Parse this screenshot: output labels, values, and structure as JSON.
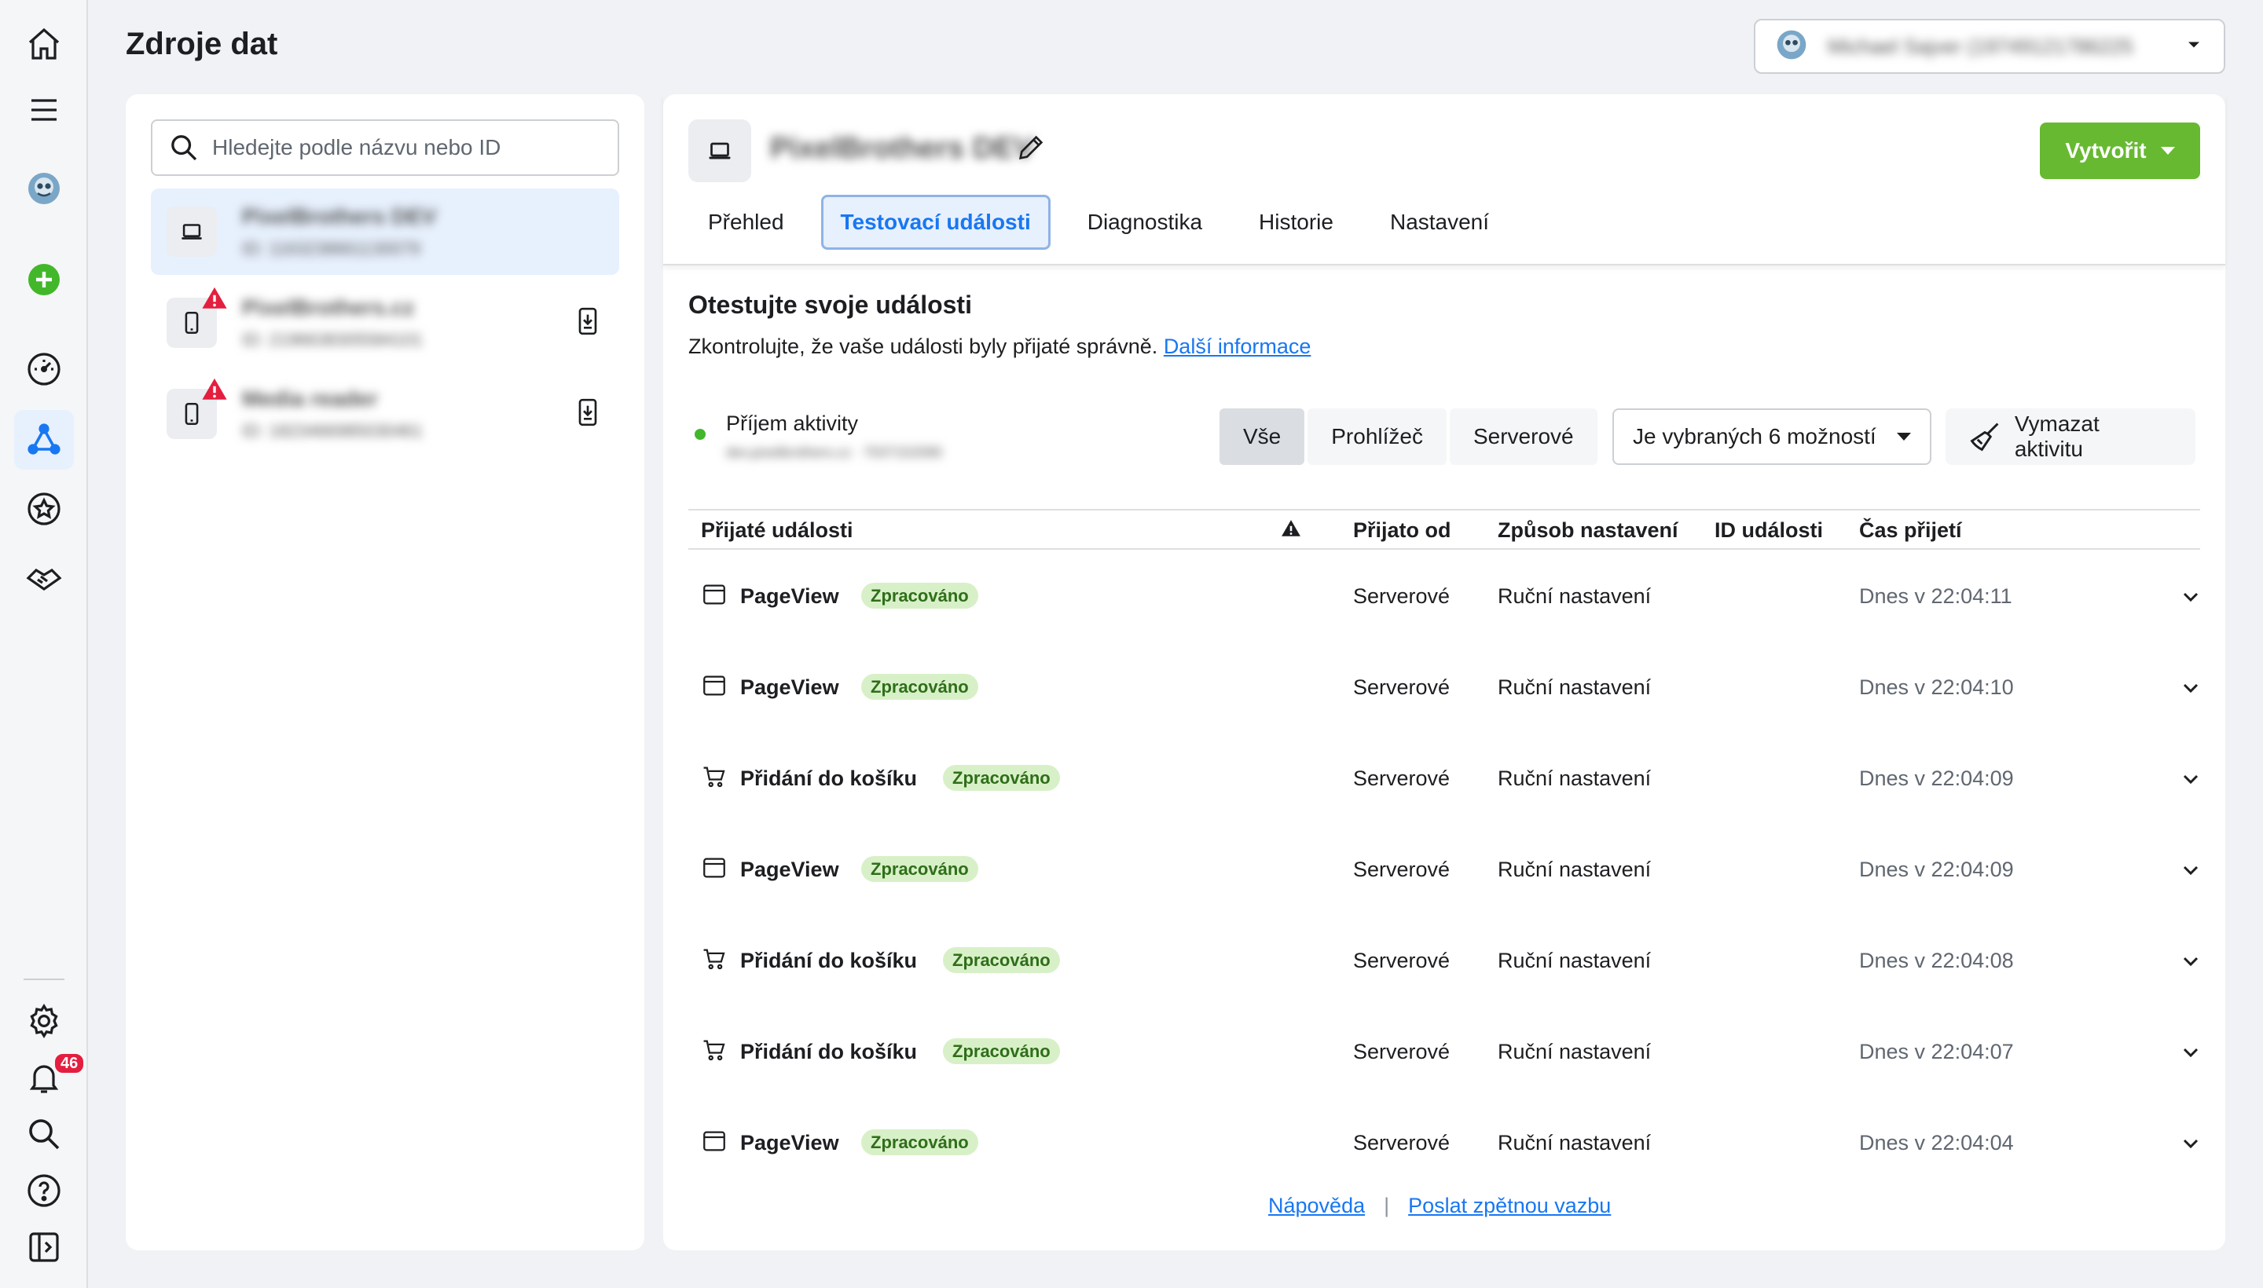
{
  "header": {
    "title": "Zdroje dat",
    "account_name": "Michael Sajver (19749121786225"
  },
  "rail": {
    "notification_count": "46"
  },
  "sources": {
    "search_placeholder": "Hledejte podle názvu nebo ID",
    "items": [
      {
        "name": "PixelBrothers DEV",
        "id": "ID: 1163238661130079",
        "selected": true,
        "warning": false
      },
      {
        "name": "PixelBrothers.cz",
        "id": "ID: 2196638305584101",
        "selected": false,
        "warning": true
      },
      {
        "name": "Media reader",
        "id": "ID: 1823466985030461",
        "selected": false,
        "warning": true
      }
    ]
  },
  "main": {
    "dataset_name": "PixelBrothers DEV",
    "create_label": "Vytvořit",
    "tabs": [
      {
        "label": "Přehled",
        "active": false
      },
      {
        "label": "Testovací události",
        "active": true
      },
      {
        "label": "Diagnostika",
        "active": false
      },
      {
        "label": "Historie",
        "active": false
      },
      {
        "label": "Nastavení",
        "active": false
      }
    ],
    "section_title": "Otestujte svoje události",
    "section_desc": "Zkontrolujte, že vaše události byly přijaté správně.",
    "section_link": "Další informace",
    "activity_label": "Příjem aktivity",
    "activity_sub": "dev.pixelbrothers.cz  ·  7037152090",
    "segments": [
      "Vše",
      "Prohlížeč",
      "Serverové"
    ],
    "filter_label": "Je vybraných 6 možností",
    "clear_label": "Vymazat aktivitu"
  },
  "table": {
    "headers": {
      "events": "Přijaté události",
      "received_from": "Přijato od",
      "setup": "Způsob nastavení",
      "event_id": "ID události",
      "time": "Čas přijetí"
    },
    "rows": [
      {
        "icon": "browser-icon",
        "name": "PageView",
        "status": "Zpracováno",
        "from": "Serverové",
        "setup": "Ruční nastavení",
        "time": "Dnes v 22:04:11"
      },
      {
        "icon": "browser-icon",
        "name": "PageView",
        "status": "Zpracováno",
        "from": "Serverové",
        "setup": "Ruční nastavení",
        "time": "Dnes v 22:04:10"
      },
      {
        "icon": "cart-icon",
        "name": "Přidání do košíku",
        "status": "Zpracováno",
        "from": "Serverové",
        "setup": "Ruční nastavení",
        "time": "Dnes v 22:04:09"
      },
      {
        "icon": "browser-icon",
        "name": "PageView",
        "status": "Zpracováno",
        "from": "Serverové",
        "setup": "Ruční nastavení",
        "time": "Dnes v 22:04:09"
      },
      {
        "icon": "cart-icon",
        "name": "Přidání do košíku",
        "status": "Zpracováno",
        "from": "Serverové",
        "setup": "Ruční nastavení",
        "time": "Dnes v 22:04:08"
      },
      {
        "icon": "cart-icon",
        "name": "Přidání do košíku",
        "status": "Zpracováno",
        "from": "Serverové",
        "setup": "Ruční nastavení",
        "time": "Dnes v 22:04:07"
      },
      {
        "icon": "browser-icon",
        "name": "PageView",
        "status": "Zpracováno",
        "from": "Serverové",
        "setup": "Ruční nastavení",
        "time": "Dnes v 22:04:04"
      }
    ]
  },
  "footer": {
    "help": "Nápověda",
    "separator": "|",
    "feedback": "Poslat zpětnou vazbu"
  },
  "colors": {
    "accent": "#1877f2",
    "create_button": "#67b931",
    "status_badge_bg": "#d8f0c7",
    "warning": "#e41e3f"
  }
}
